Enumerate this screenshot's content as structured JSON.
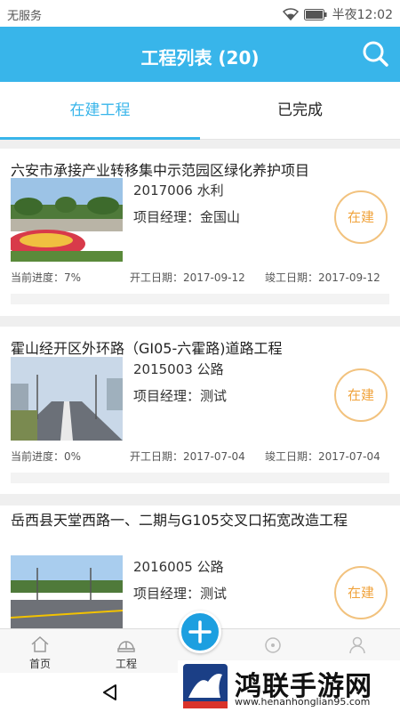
{
  "status_bar": {
    "carrier": "无服务",
    "time": "半夜12:02"
  },
  "app_bar": {
    "title": "工程列表 (20)",
    "search_icon": "search-icon"
  },
  "tabs": [
    {
      "label": "在建工程",
      "active": true
    },
    {
      "label": "已完成",
      "active": false
    }
  ],
  "projects": [
    {
      "name": "六安市承接产业转移集中示范园区绿化养护项目",
      "code": "2017006 水利",
      "manager": "项目经理：金国山",
      "status": "在建",
      "progress": "当前进度：7%",
      "start": "开工日期：2017-09-12",
      "end": "竣工日期：2017-09-12"
    },
    {
      "name": "霍山经开区外环路（GI05-六霍路)道路工程",
      "code": "2015003 公路",
      "manager": "项目经理：测试",
      "status": "在建",
      "progress": "当前进度：0%",
      "start": "开工日期：2017-07-04",
      "end": "竣工日期：2017-07-04"
    },
    {
      "name": "岳西县天堂西路一、二期与G105交叉口拓宽改造工程",
      "code": "2016005 公路",
      "manager": "项目经理：测试",
      "status": "在建"
    }
  ],
  "bottom_nav": [
    {
      "label": "首页",
      "icon": "home-icon"
    },
    {
      "label": "工程",
      "icon": "helmet-icon"
    },
    {
      "label": "",
      "icon": "add-icon"
    },
    {
      "label": "",
      "icon": "compass-icon"
    },
    {
      "label": "",
      "icon": "user-icon"
    }
  ],
  "watermark": {
    "text": "鸿联手游网",
    "url": "www.henanhonglian95.com"
  },
  "colors": {
    "primary": "#38b5ea",
    "badge": "#f0a33c",
    "fab": "#1c9fe0"
  }
}
